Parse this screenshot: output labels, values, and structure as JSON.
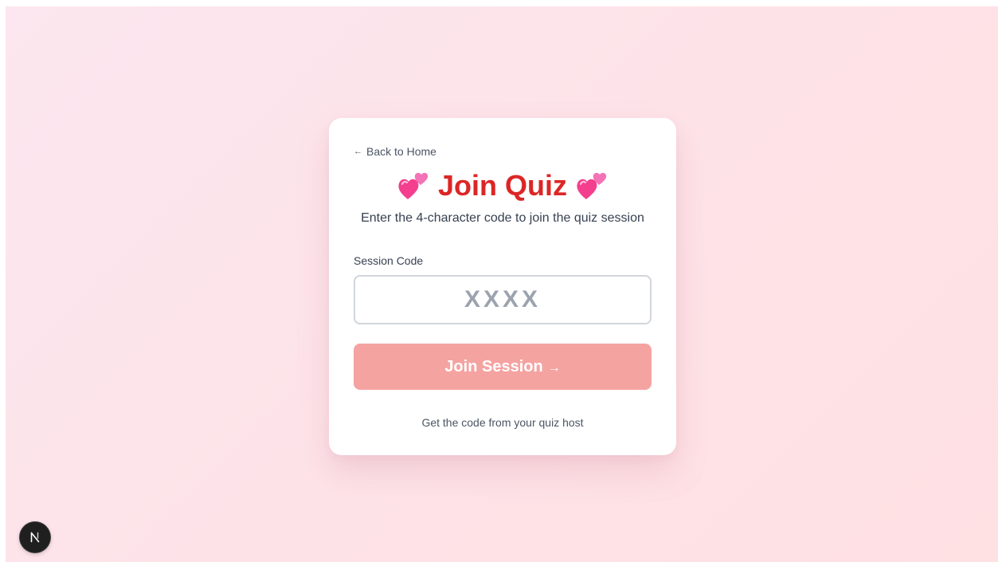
{
  "page": {
    "background_start": "#fce6ef",
    "background_end": "#ffe0e3"
  },
  "card": {
    "back_link": {
      "arrow": "←",
      "label": "Back to Home"
    },
    "title": {
      "text": "Join Quiz",
      "icon": "two-hearts-icon",
      "color": "#dc2626"
    },
    "subtitle": "Enter the 4-character code to join the quiz session",
    "session_code": {
      "label": "Session Code",
      "placeholder": "XXXX",
      "value": ""
    },
    "join_button": {
      "label": "Join Session",
      "arrow": "→",
      "color": "#f5a3a1"
    },
    "hint": "Get the code from your quiz host"
  },
  "dev_badge": {
    "icon": "nextjs-logo-icon",
    "letter": "N"
  }
}
